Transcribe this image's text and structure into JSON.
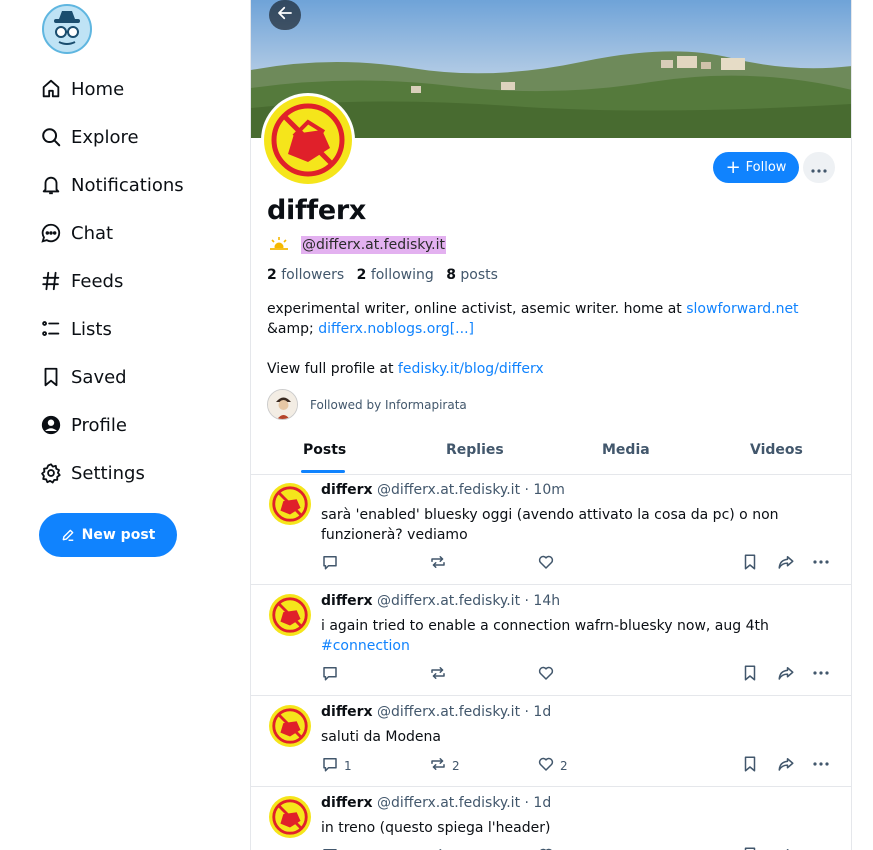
{
  "nav": {
    "items": [
      {
        "label": "Home",
        "icon": "home-icon"
      },
      {
        "label": "Explore",
        "icon": "search-icon"
      },
      {
        "label": "Notifications",
        "icon": "bell-icon"
      },
      {
        "label": "Chat",
        "icon": "chat-icon"
      },
      {
        "label": "Feeds",
        "icon": "hash-icon"
      },
      {
        "label": "Lists",
        "icon": "list-icon"
      },
      {
        "label": "Saved",
        "icon": "bookmark-icon"
      },
      {
        "label": "Profile",
        "icon": "user-icon"
      },
      {
        "label": "Settings",
        "icon": "gear-icon"
      }
    ],
    "new_post_label": "New post"
  },
  "profile": {
    "display_name": "differx",
    "handle": "@differx.at.fedisky.it",
    "followers_count": "2",
    "followers_label": "followers",
    "following_count": "2",
    "following_label": "following",
    "posts_count": "8",
    "posts_label": "posts",
    "follow_label": "Follow",
    "bio_text_1": "experimental writer, online activist, asemic writer. home at ",
    "bio_link_1": "slowforward.net",
    "bio_text_2": "&amp; ",
    "bio_link_2": "differx.noblogs.org[...]",
    "profile_link_prefix": "View full profile at ",
    "profile_link": "fedisky.it/blog/differx",
    "followed_by": "Followed by Informapirata"
  },
  "tabs": [
    "Posts",
    "Replies",
    "Media",
    "Videos"
  ],
  "posts": [
    {
      "name": "differx",
      "handle": "@differx.at.fedisky.it",
      "time": "· 10m",
      "text": "sarà 'enabled' bluesky oggi (avendo attivato la cosa da pc) o non funzionerà? vediamo",
      "tag": "",
      "replies": "",
      "reposts": "",
      "likes": ""
    },
    {
      "name": "differx",
      "handle": "@differx.at.fedisky.it",
      "time": "· 14h",
      "text": "i again tried to enable a connection wafrn-bluesky now, aug 4th",
      "tag": "#connection",
      "replies": "",
      "reposts": "",
      "likes": ""
    },
    {
      "name": "differx",
      "handle": "@differx.at.fedisky.it",
      "time": "· 1d",
      "text": "saluti da Modena",
      "tag": "",
      "replies": "1",
      "reposts": "2",
      "likes": "2"
    },
    {
      "name": "differx",
      "handle": "@differx.at.fedisky.it",
      "time": "· 1d",
      "text": "in treno (questo spiega l'header)",
      "tag": "",
      "replies": "",
      "reposts": "",
      "likes": ""
    }
  ],
  "colors": {
    "accent": "#1083fe",
    "handle_highlight": "#e3b1f0",
    "muted_text": "#42576c",
    "avatar_yellow": "#f5e51b",
    "avatar_red": "#e0202a"
  }
}
